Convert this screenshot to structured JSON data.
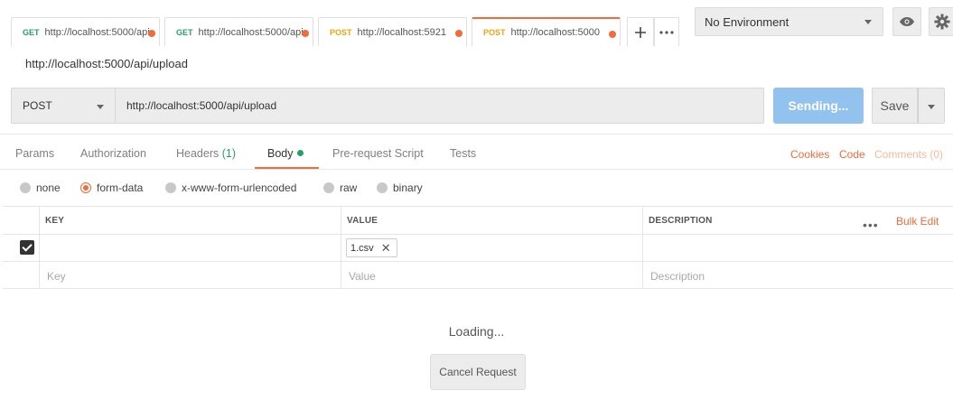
{
  "tabs": [
    {
      "method": "GET",
      "url": "http://localhost:5000/api"
    },
    {
      "method": "GET",
      "url": "http://localhost:5000/api"
    },
    {
      "method": "POST",
      "url": "http://localhost:5921"
    },
    {
      "method": "POST",
      "url": "http://localhost:5000"
    }
  ],
  "environment": {
    "selected": "No Environment"
  },
  "request": {
    "name": "http://localhost:5000/api/upload",
    "method": "POST",
    "url": "http://localhost:5000/api/upload",
    "send_label": "Sending...",
    "save_label": "Save"
  },
  "request_tabs": {
    "params": "Params",
    "authorization": "Authorization",
    "headers": "Headers",
    "headers_count": "(1)",
    "body": "Body",
    "prerequest": "Pre-request Script",
    "tests": "Tests",
    "cookies": "Cookies",
    "code": "Code",
    "comments": "Comments (0)"
  },
  "body_types": {
    "none": "none",
    "form_data": "form-data",
    "urlencoded": "x-www-form-urlencoded",
    "raw": "raw",
    "binary": "binary",
    "selected": "form-data"
  },
  "form_table": {
    "headers": {
      "key": "KEY",
      "value": "VALUE",
      "description": "DESCRIPTION"
    },
    "bulk_edit": "Bulk Edit",
    "rows": [
      {
        "checked": true,
        "key": "",
        "file": "1.csv",
        "description": ""
      }
    ],
    "placeholders": {
      "key": "Key",
      "value": "Value",
      "description": "Description"
    }
  },
  "response": {
    "loading": "Loading...",
    "cancel_label": "Cancel Request"
  },
  "colors": {
    "accent": "#f26b3a",
    "get": "#26a069",
    "post": "#f0a30a",
    "send": "#92c2ee"
  }
}
